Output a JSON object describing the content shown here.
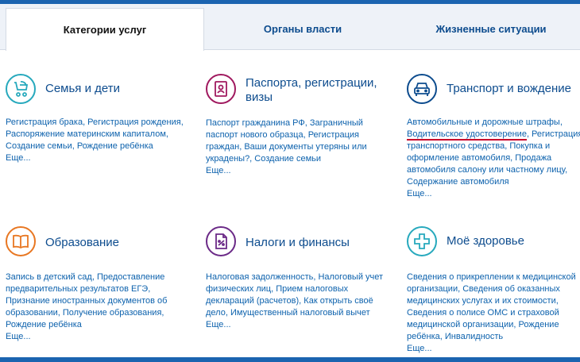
{
  "tabs": [
    {
      "label": "Категории услуг"
    },
    {
      "label": "Органы власти"
    },
    {
      "label": "Жизненные ситуации"
    }
  ],
  "colors": {
    "teal": "#27a9bd",
    "magenta": "#a0195f",
    "navy": "#0d4c8e",
    "orange": "#e87722",
    "purple": "#6b2a87",
    "underline": "#c7002b"
  },
  "cards": [
    {
      "title": "Семья и дети",
      "icon": "stroller-icon",
      "links": [
        "Регистрация брака, Регистрация рождения,",
        "Распоряжение материнским капиталом,",
        "Создание семьи, Рождение ребёнка"
      ],
      "more": "Еще..."
    },
    {
      "title": "Паспорта, регистрации, визы",
      "icon": "passport-icon",
      "links": [
        "Паспорт гражданина РФ, Заграничный",
        "паспорт нового образца, Регистрация",
        "граждан, Ваши документы утеряны или",
        "украдены?, Создание семьи"
      ],
      "more": "Еще..."
    },
    {
      "title": "Транспорт и вождение",
      "icon": "car-icon",
      "links": [
        "Автомобильные и дорожные штрафы,",
        "Водительское удостоверение",
        ", Регистрация",
        "транспортного средства, Покупка и",
        "оформление автомобиля, Продажа",
        "автомобиля салону или частному лицу,",
        "Содержание автомобиля"
      ],
      "more": "Еще..."
    },
    {
      "title": "Образование",
      "icon": "book-icon",
      "links": [
        "Запись в детский сад, Предоставление",
        "предварительных результатов ЕГЭ,",
        "Признание иностранных документов об",
        "образовании, Получение образования,",
        "Рождение ребёнка"
      ],
      "more": "Еще..."
    },
    {
      "title": "Налоги и финансы",
      "icon": "tax-document-icon",
      "links": [
        "Налоговая задолженность, Налоговый учет",
        "физических лиц, Прием налоговых",
        "деклараций (расчетов), Как открыть своё",
        "дело, Имущественный налоговый вычет"
      ],
      "more": "Еще..."
    },
    {
      "title": "Моё здоровье",
      "icon": "medical-cross-icon",
      "links": [
        "Сведения о прикреплении к медицинской",
        "организации, Сведения об оказанных",
        "медицинских услугах и их стоимости,",
        "Сведения о полисе ОМС и страховой",
        "медицинской организации, Рождение",
        "ребёнка, Инвалидность"
      ],
      "more": "Еще..."
    }
  ]
}
